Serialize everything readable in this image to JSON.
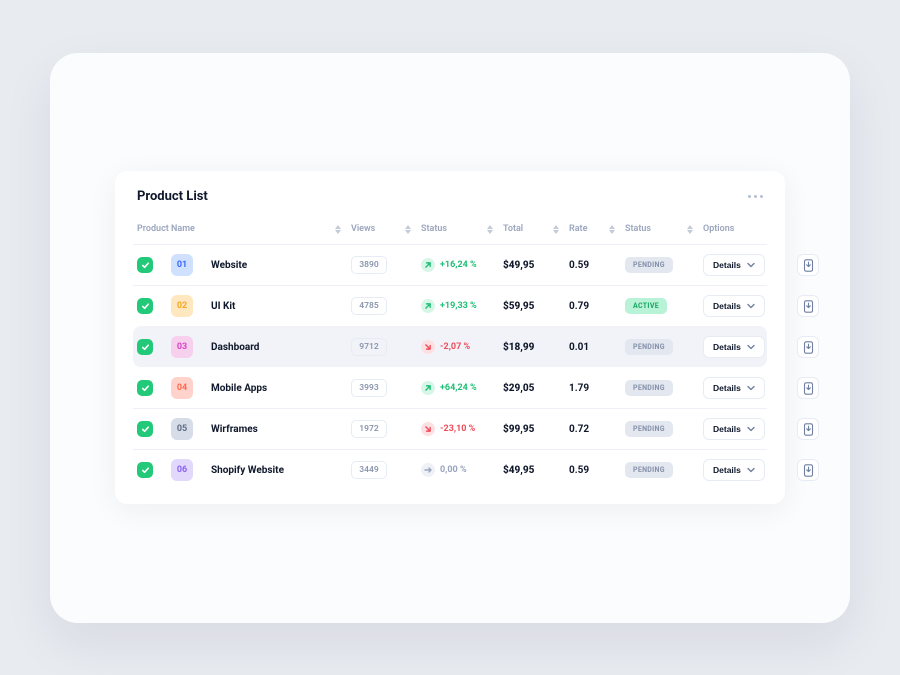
{
  "panel": {
    "title": "Product List",
    "headers": {
      "product_name": "Product Name",
      "views": "Views",
      "status_trend": "Status",
      "total": "Total",
      "rate": "Rate",
      "status": "Status",
      "options": "Options"
    }
  },
  "buttons": {
    "details": "Details"
  },
  "status_labels": {
    "pending": "PENDING",
    "active": "ACTIVE"
  },
  "rows": [
    {
      "index": "01",
      "badge_bg": "#cfe1ff",
      "badge_fg": "#3b68ff",
      "name": "Website",
      "views": "3890",
      "trend_dir": "up",
      "trend_text": "+16,24 %",
      "total": "$49,95",
      "rate": "0.59",
      "status": "pending",
      "active": false
    },
    {
      "index": "02",
      "badge_bg": "#ffe7bf",
      "badge_fg": "#f5a623",
      "name": "UI Kit",
      "views": "4785",
      "trend_dir": "up",
      "trend_text": "+19,33 %",
      "total": "$59,95",
      "rate": "0.79",
      "status": "active",
      "active": false
    },
    {
      "index": "03",
      "badge_bg": "#f7d0ee",
      "badge_fg": "#d946c6",
      "name": "Dashboard",
      "views": "9712",
      "trend_dir": "down",
      "trend_text": "-2,07 %",
      "total": "$18,99",
      "rate": "0.01",
      "status": "pending",
      "active": true
    },
    {
      "index": "04",
      "badge_bg": "#ffd3cc",
      "badge_fg": "#ff6a52",
      "name": "Mobile Apps",
      "views": "3993",
      "trend_dir": "up",
      "trend_text": "+64,24 %",
      "total": "$29,05",
      "rate": "1.79",
      "status": "pending",
      "active": false
    },
    {
      "index": "05",
      "badge_bg": "#d7dde8",
      "badge_fg": "#5d6b85",
      "name": "Wirframes",
      "views": "1972",
      "trend_dir": "down",
      "trend_text": "-23,10 %",
      "total": "$99,95",
      "rate": "0.72",
      "status": "pending",
      "active": false
    },
    {
      "index": "06",
      "badge_bg": "#e2d8fb",
      "badge_fg": "#8a63f0",
      "name": "Shopify Website",
      "views": "3449",
      "trend_dir": "flat",
      "trend_text": "0,00 %",
      "total": "$49,95",
      "rate": "0.59",
      "status": "pending",
      "active": false
    }
  ]
}
